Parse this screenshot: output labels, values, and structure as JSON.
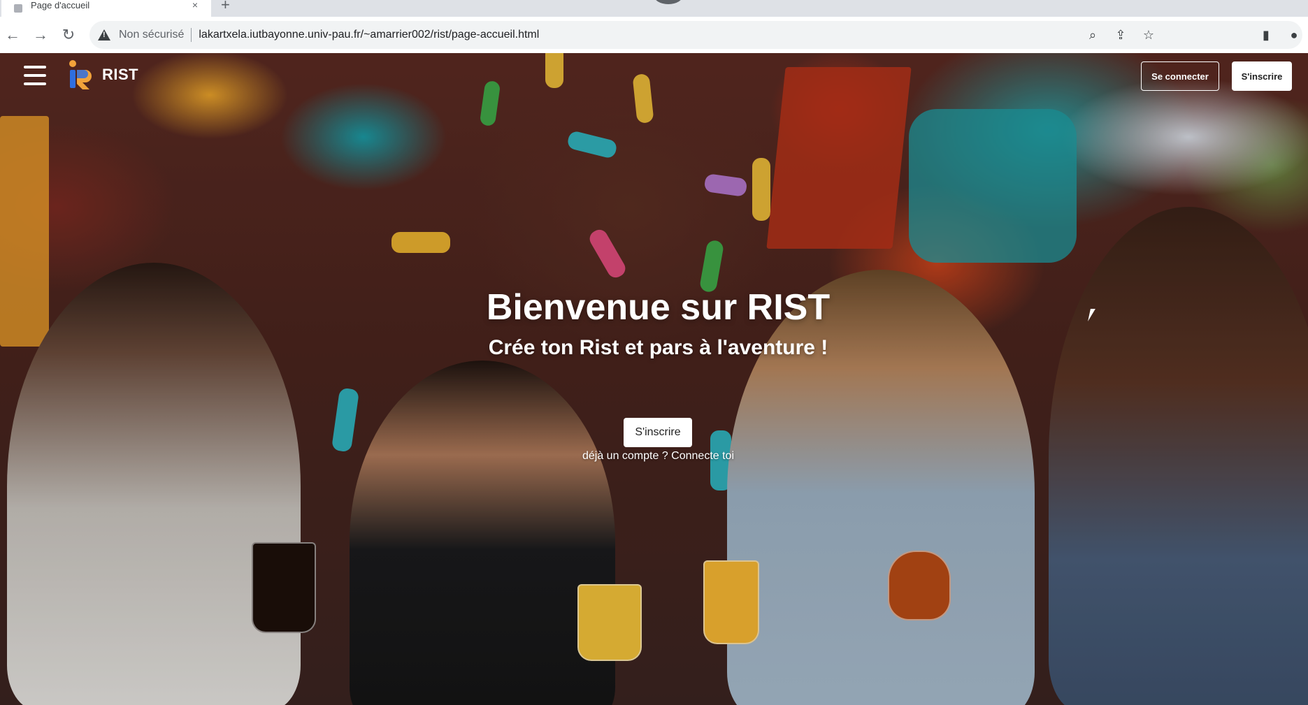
{
  "browser": {
    "tab": {
      "title": "Page d'accueil",
      "close": "×"
    },
    "new_tab": "+",
    "nav": {
      "back": "←",
      "forward": "→",
      "reload": "↻"
    },
    "omnibox": {
      "security_label": "Non sécurisé",
      "url": "lakartxela.iutbayonne.univ-pau.fr/~amarrier002/rist/page-accueil.html"
    },
    "icons": {
      "zoom": "⌕",
      "share": "⇪",
      "bookmark": "☆",
      "sidepanel": "▮",
      "profile": "●"
    }
  },
  "site": {
    "brand": "RIST",
    "nav": {
      "login_label": "Se connecter",
      "signup_label": "S'inscrire"
    },
    "hero": {
      "title": "Bienvenue sur RIST",
      "subtitle": "Crée ton Rist et pars à l'aventure !",
      "cta_label": "S'inscrire",
      "hint_prefix": "déjà un compte ? ",
      "hint_link": "Connecte toi"
    },
    "colors": {
      "logo_blue": "#2f6fe0",
      "logo_orange": "#f2a33a"
    }
  }
}
